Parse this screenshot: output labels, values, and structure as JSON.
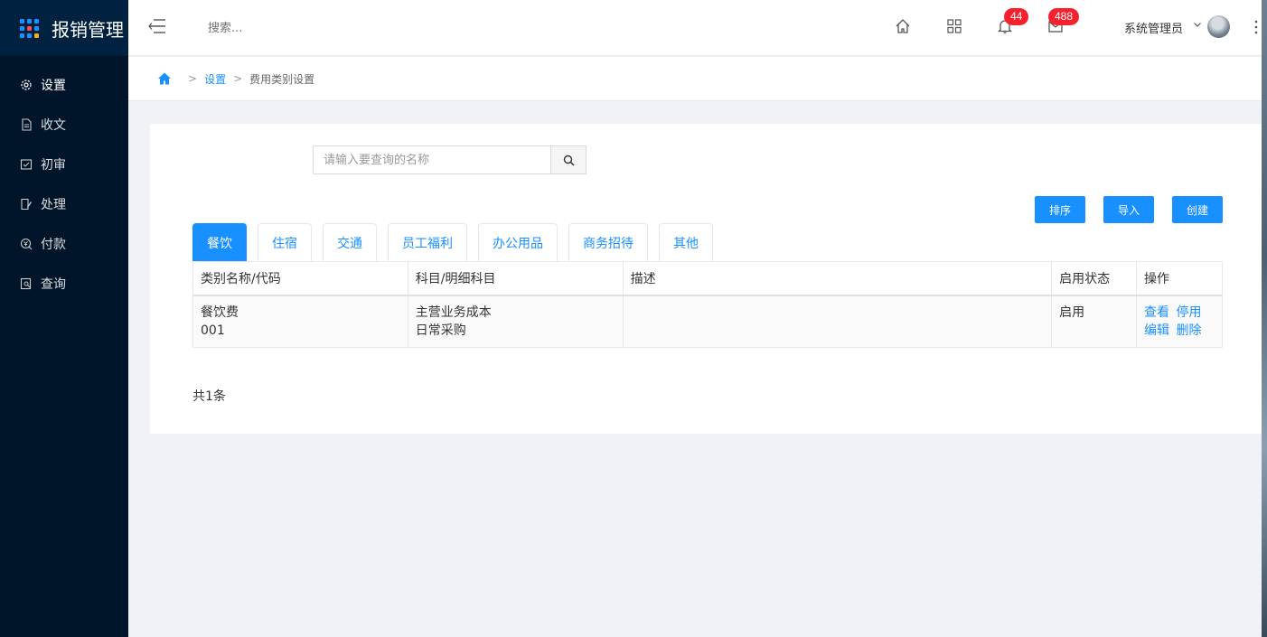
{
  "app": {
    "title": "报销管理"
  },
  "colors": {
    "sidebar": "#001529",
    "accent": "#1890ff",
    "badge": "#f5222d"
  },
  "sidebar": {
    "items": [
      {
        "label": "设置",
        "icon": "gear-icon"
      },
      {
        "label": "收文",
        "icon": "document-icon"
      },
      {
        "label": "初审",
        "icon": "review-icon"
      },
      {
        "label": "处理",
        "icon": "edit-icon"
      },
      {
        "label": "付款",
        "icon": "payment-icon"
      },
      {
        "label": "查询",
        "icon": "query-icon"
      }
    ]
  },
  "header": {
    "search_placeholder": "搜索...",
    "notifications": "44",
    "messages": "488",
    "user": "系统管理员"
  },
  "breadcrumb": {
    "level1": "设置",
    "level2": "费用类别设置",
    "separator": ">"
  },
  "main": {
    "search_placeholder": "请输入要查询的名称",
    "buttons": {
      "sort": "排序",
      "import": "导入",
      "create": "创建"
    },
    "tabs": [
      "餐饮",
      "住宿",
      "交通",
      "员工福利",
      "办公用品",
      "商务招待",
      "其他"
    ],
    "active_tab": "餐饮",
    "table": {
      "headers": [
        "类别名称/代码",
        "科目/明细科目",
        "描述",
        "启用状态",
        "操作"
      ],
      "rows": [
        {
          "name": "餐饮费",
          "code": "001",
          "subject": "主营业务成本",
          "detail_subject": "日常采购",
          "description": "",
          "status": "启用",
          "actions": {
            "view": "查看",
            "disable": "停用",
            "edit": "编辑",
            "delete": "删除"
          }
        }
      ]
    },
    "total": "共1条"
  }
}
